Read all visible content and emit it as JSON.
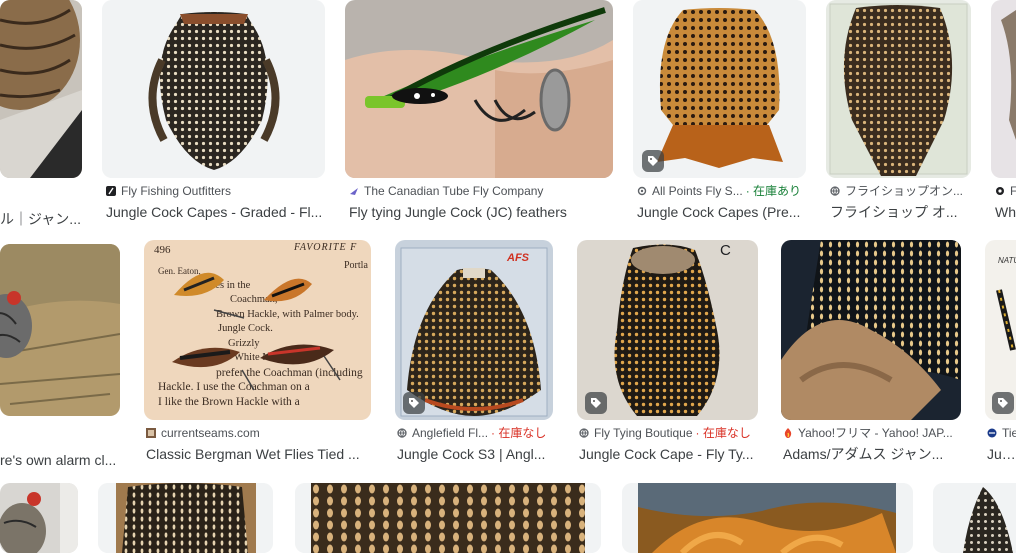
{
  "results": {
    "row1": [
      {
        "source": "",
        "title": "ル｜ジャン..."
      },
      {
        "source": "Fly Fishing Outfitters",
        "title": "Jungle Cock Capes - Graded - Fl..."
      },
      {
        "source": "The Canadian Tube Fly Company",
        "title": "Fly tying Jungle Cock (JC) feathers"
      },
      {
        "source": "All Points Fly S...",
        "stock": "· 在庫あり",
        "title": "Jungle Cock Capes (Pre..."
      },
      {
        "source": "フライショップオン...",
        "title": "フライショップ オ..."
      },
      {
        "source": "F",
        "title": "Wh"
      }
    ],
    "row2": [
      {
        "source": "",
        "title": "re's own alarm cl..."
      },
      {
        "source": "currentseams.com",
        "title": "Classic Bergman Wet Flies Tied ..."
      },
      {
        "source": "Anglefield Fl...",
        "stock": "· 在庫なし",
        "title": "Jungle Cock S3 | Angl..."
      },
      {
        "source": "Fly Tying Boutique",
        "stock": "· 在庫なし",
        "title": "Jungle Cock Cape - Fly Ty..."
      },
      {
        "source": "Yahoo!フリマ - Yahoo! JAP...",
        "title": "Adams/アダムス ジャン..."
      },
      {
        "source": "Tie",
        "title": "Jung"
      }
    ]
  },
  "book_text": {
    "page_no": "496",
    "header": "FAVORITE F",
    "side": "Portla",
    "lines": [
      "Gen. Eaton,",
      "flies in the",
      "Coachman,",
      "Brown Hackle, with Palmer body.",
      "Jungle Cock.",
      "Grizzly",
      "White Mille",
      "prefer the Coachman (including",
      "Hackle. I use the Coachman on a",
      "I like the Brown Hackle with a"
    ]
  },
  "wrapper_label": "AFS",
  "corner_letter": "C",
  "tag_label": "NATU"
}
